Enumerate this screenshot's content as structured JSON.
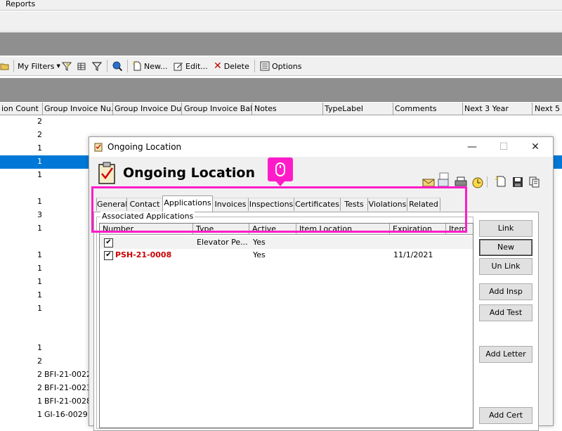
{
  "app": {
    "menu_label": "Reports"
  },
  "toolbar": {
    "filters_label": "My Filters",
    "new_label": "New...",
    "edit_label": "Edit...",
    "delete_label": "Delete",
    "options_label": "Options"
  },
  "grid": {
    "columns": [
      "ion Count",
      "Group Invoice Nu...",
      "Group Invoice Du...",
      "Group Invoice Bal...",
      "Notes",
      "TypeLabel",
      "Comments",
      "Next 3 Year",
      "Next 5 Y"
    ],
    "rows": [
      {
        "count": "2",
        "invoice": ""
      },
      {
        "count": "2",
        "invoice": ""
      },
      {
        "count": "1",
        "invoice": ""
      },
      {
        "count": "1",
        "invoice": "",
        "selected": true
      },
      {
        "count": "1",
        "invoice": ""
      },
      {
        "count": "1",
        "invoice": ""
      },
      {
        "count": "3",
        "invoice": ""
      },
      {
        "count": "1",
        "invoice": ""
      },
      {
        "count": "1",
        "invoice": ""
      },
      {
        "count": "1",
        "invoice": ""
      },
      {
        "count": "1",
        "invoice": ""
      },
      {
        "count": "1",
        "invoice": ""
      },
      {
        "count": "1",
        "invoice": ""
      },
      {
        "count": "1",
        "invoice": ""
      },
      {
        "count": "2",
        "invoice": ""
      },
      {
        "count": "2",
        "invoice": "BFI-21-0022"
      },
      {
        "count": "2",
        "invoice": "BFI-21-0023"
      },
      {
        "count": "1",
        "invoice": "BFI-21-0028"
      },
      {
        "count": "1",
        "invoice": "GI-16-0029"
      }
    ]
  },
  "dialog": {
    "window_title": "Ongoing Location",
    "header_title": "Ongoing Location",
    "tabs": [
      "General",
      "Contact",
      "Applications",
      "Invoices",
      "Inspections",
      "Certificates",
      "Tests",
      "Violations",
      "Related"
    ],
    "active_tab": "Applications",
    "group_label": "Associated Applications",
    "columns": [
      "Number",
      "Type",
      "Active",
      "Item Location",
      "Expiration",
      "Item"
    ],
    "applications": [
      {
        "checked": "✔",
        "number": "",
        "type": "Elevator Pe...",
        "active": "Yes",
        "location": "",
        "expiration": ""
      },
      {
        "checked": "✔",
        "number": "PSH-21-0008",
        "type": "",
        "active": "Yes",
        "location": "",
        "expiration": "11/1/2021"
      }
    ],
    "buttons": {
      "link": "Link",
      "new": "New",
      "unlink": "Un Link",
      "add_insp": "Add Insp",
      "add_test": "Add Test",
      "add_letter": "Add Letter",
      "add_cert": "Add Cert"
    },
    "close_glyph": "✕",
    "minimize_glyph": "—",
    "maximize_glyph": "☐"
  },
  "colors": {
    "highlight": "#ff1cc8",
    "selection": "#0078d7",
    "invoice_red": "#cc0000"
  }
}
